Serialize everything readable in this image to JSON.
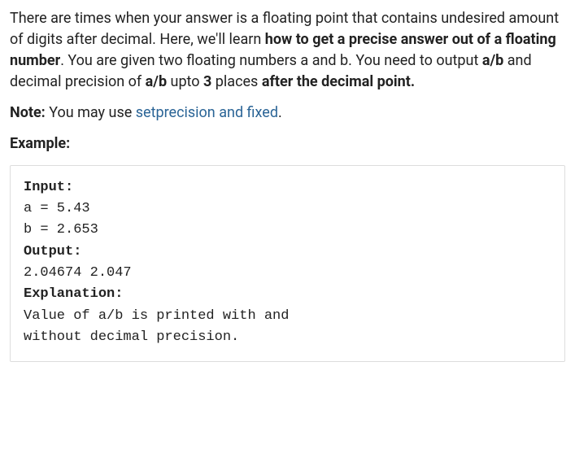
{
  "intro": {
    "t1": "There are times when your answer is a floating point that contains undesired amount of digits after decimal. Here, we'll learn ",
    "b1": "how to get a precise answer out of a floating number",
    "t2": ". You are given two floating numbers a and b. You need to output ",
    "b2": "a/b",
    "t3": " and decimal precision of ",
    "b3": "a/b",
    "t4": " upto ",
    "b4": "3",
    "t5": " places ",
    "b5": "after the decimal point."
  },
  "note": {
    "label": "Note:",
    "text": " You may use ",
    "link": "setprecision and fixed",
    "after": "."
  },
  "example_label": "Example:",
  "code": {
    "input_label": "Input:",
    "line1": "a = 5.43",
    "line2": "b = 2.653",
    "output_label": "Output:",
    "output_line": "2.04674 2.047",
    "explanation_label": "Explanation:",
    "exp1": "Value of a/b is printed with and",
    "exp2": "without decimal precision."
  }
}
